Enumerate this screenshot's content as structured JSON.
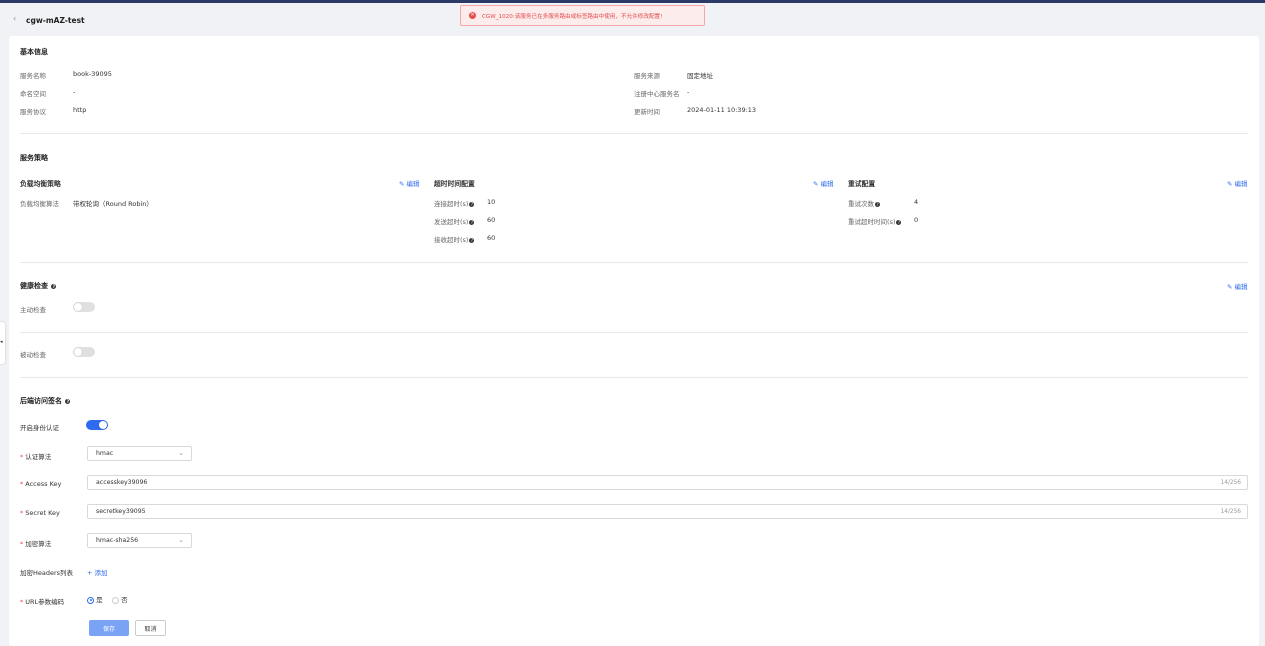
{
  "header": {
    "title": "cgw-mAZ-test",
    "back_icon": "chevron-left-icon"
  },
  "toast": {
    "message": "CGW_1020:该服务已在多服务路由或标签路由中使用，不允许修改配置!",
    "color": "#e34d4d"
  },
  "basic": {
    "title": "基本信息",
    "fields": [
      {
        "label": "服务名称",
        "value": "book-39095"
      },
      {
        "label": "命名空间",
        "value": "-"
      },
      {
        "label": "服务协议",
        "value": "http"
      },
      {
        "label": "服务来源",
        "value": "固定地址"
      },
      {
        "label": "注册中心服务名",
        "value": "-"
      },
      {
        "label": "更新时间",
        "value": "2024-01-11 10:39:13"
      }
    ]
  },
  "strategy": {
    "title": "服务策略",
    "edit_label": "编辑",
    "lb": {
      "title": "负载均衡策略",
      "fields": [
        {
          "label": "负载均衡算法",
          "value": "带权轮询（Round Robin）"
        }
      ]
    },
    "timeout": {
      "title": "超时时间配置",
      "fields": [
        {
          "label": "连接超时(s)",
          "value": "10"
        },
        {
          "label": "发送超时(s)",
          "value": "60"
        },
        {
          "label": "接收超时(s)",
          "value": "60"
        }
      ]
    },
    "retry": {
      "title": "重试配置",
      "fields": [
        {
          "label": "重试次数",
          "value": "4"
        },
        {
          "label": "重试超时时间(s)",
          "value": "0"
        }
      ]
    }
  },
  "health": {
    "title": "健康检查",
    "edit_label": "编辑",
    "active_label": "主动检查",
    "active_on": false,
    "passive_label": "被动检查",
    "passive_on": false
  },
  "backend": {
    "title": "后端访问签名",
    "auth_label": "开启身份认证",
    "auth_on": true,
    "algo_label": "认证算法",
    "algo_value": "hmac",
    "ak_label": "Access Key",
    "ak_value": "accesskey39096",
    "ak_count": "14/256",
    "sk_label": "Secret Key",
    "sk_value": "secretkey39095",
    "sk_count": "14/256",
    "enc_label": "加密算法",
    "enc_value": "hmac-sha256",
    "headers_label": "加密Headers列表",
    "add_label": "+ 添加",
    "url_label": "URL参数编码",
    "yes_label": "是",
    "no_label": "否",
    "url_encode": "是"
  },
  "actions": {
    "save_label": "保存",
    "cancel_label": "取消"
  },
  "colors": {
    "accent": "#2f6bf0",
    "primary_button": "#7ba3f5"
  }
}
